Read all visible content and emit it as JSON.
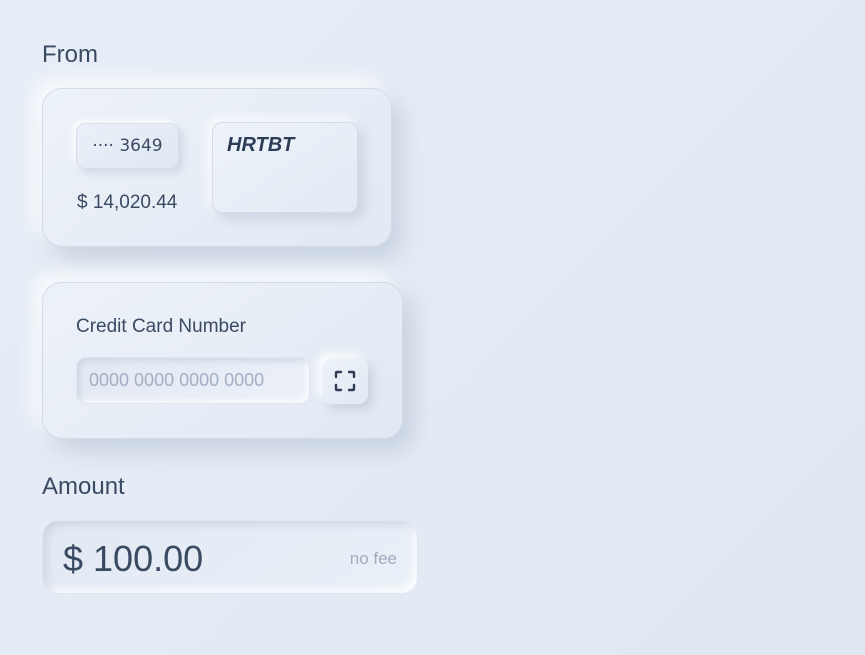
{
  "from": {
    "label": "From",
    "account_masked": "···· 3649",
    "balance": "$ 14,020.44",
    "card_brand": "HRTBT"
  },
  "credit_card": {
    "label": "Credit Card Number",
    "placeholder": "0000 0000 0000 0000",
    "value": "",
    "scan_icon": "scan-frame-icon"
  },
  "amount": {
    "label": "Amount",
    "value": "$ 100.00",
    "fee_note": "no fee"
  },
  "colors": {
    "background": "#e5ecf6",
    "text": "#3b4a63",
    "muted": "#a1acbe"
  }
}
